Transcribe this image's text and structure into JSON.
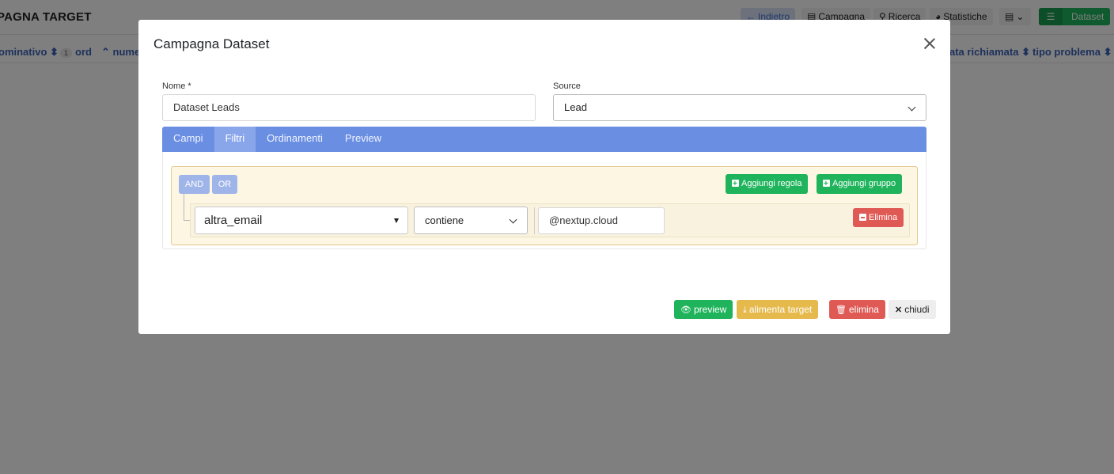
{
  "background": {
    "title": "PAGNA TARGET",
    "nav": [
      {
        "icon": "arrow-left-icon",
        "label": "Indietro",
        "glyph": "←"
      },
      {
        "icon": "table-icon",
        "label": "Campagna",
        "glyph": "▤"
      },
      {
        "icon": "search-icon",
        "label": "Ricerca",
        "glyph": "⚲"
      },
      {
        "icon": "pie-chart-icon",
        "label": "Statistiche",
        "glyph": "◕"
      },
      {
        "icon": "list-icon",
        "label": "Dataset",
        "glyph": "☰"
      }
    ],
    "columns": [
      {
        "label": "ominativo",
        "sort": "⬍"
      },
      {
        "label": "ord",
        "badge": "1"
      },
      {
        "label": "nume",
        "sort": "⌃"
      },
      {
        "label": "ata richiamata",
        "sort": "⬍"
      },
      {
        "label": "tipo problema",
        "sort": "⬍"
      }
    ]
  },
  "modal": {
    "title": "Campagna Dataset",
    "nome_label": "Nome *",
    "nome_value": "Dataset Leads",
    "source_label": "Source",
    "source_value": "Lead",
    "tabs": [
      {
        "label": "Campi",
        "active": false
      },
      {
        "label": "Filtri",
        "active": true
      },
      {
        "label": "Ordinamenti",
        "active": false
      },
      {
        "label": "Preview",
        "active": false
      }
    ],
    "query_builder": {
      "and_label": "AND",
      "or_label": "OR",
      "add_rule_label": "Aggiungi regola",
      "add_group_label": "Aggiungi gruppo",
      "rule": {
        "field": "altra_email",
        "operator": "contiene",
        "value": "@nextup.cloud",
        "delete_label": "Elimina"
      }
    },
    "footer": {
      "preview_label": "preview",
      "feed_label": "alimenta target",
      "delete_label": "elimina",
      "close_label": "chiudi"
    }
  },
  "colors": {
    "tab_bar": "#6a8ee2",
    "success": "#1fb45c",
    "warning": "#e5b94c",
    "danger": "#e05a55",
    "group_bg": "#fcf6e3"
  }
}
